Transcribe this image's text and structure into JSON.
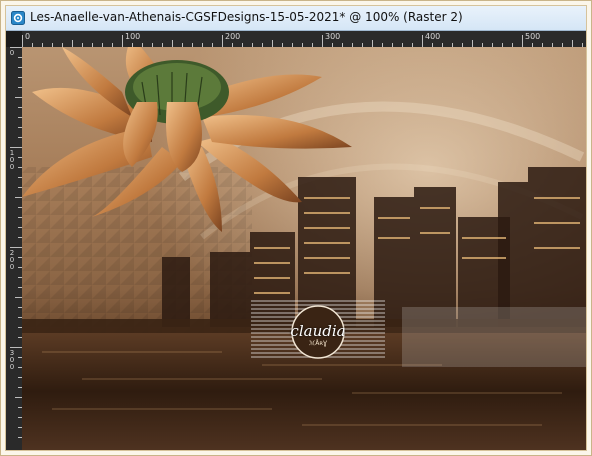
{
  "window": {
    "title": "Les-Anaelle-van-Athenais-CGSFDesigns-15-05-2021* @ 100% (Raster 2)"
  },
  "ruler": {
    "top_labels": [
      "0",
      "100",
      "200",
      "300",
      "400",
      "500"
    ],
    "left_labels": [
      "0",
      "100",
      "200",
      "300"
    ]
  },
  "watermark": {
    "text": "claudia",
    "sub": "ℳÅʀƔ"
  },
  "colors": {
    "titlebar": "#dbe9f7",
    "ruler": "#2a2a2a",
    "sepia_dark": "#3a2210",
    "sepia_light": "#e8c59a"
  }
}
